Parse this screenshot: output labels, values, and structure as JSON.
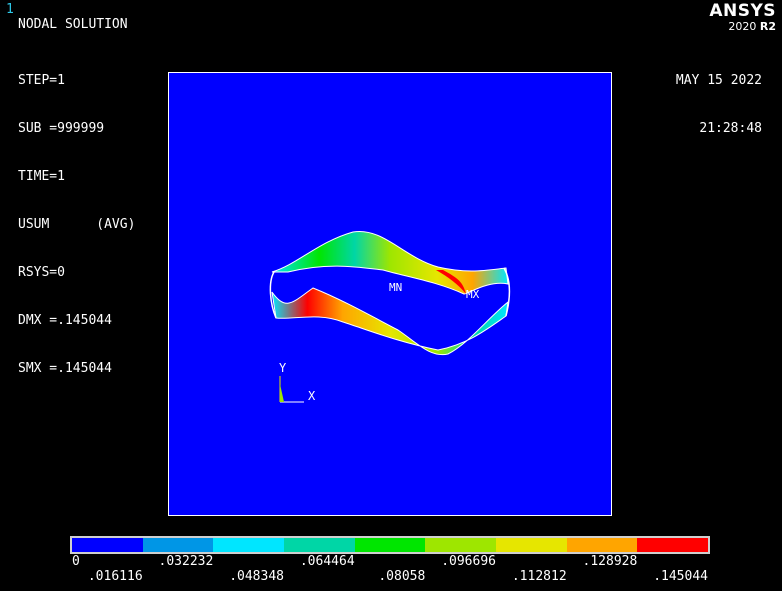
{
  "window_number": "1",
  "title": "NODAL SOLUTION",
  "info_lines": [
    "STEP=1",
    "SUB =999999",
    "TIME=1",
    "USUM      (AVG)",
    "RSYS=0",
    "DMX =.145044",
    "SMX =.145044"
  ],
  "date": "MAY 15 2022",
  "time": "21:28:48",
  "logo": {
    "brand": "ANSYS",
    "version": "2020",
    "release": "R2"
  },
  "labels": {
    "min": "MN",
    "max": "MX",
    "axis_y": "Y",
    "axis_x": "X"
  },
  "legend": {
    "colors": [
      "#0000ff",
      "#0096e6",
      "#00e6ff",
      "#00d6a6",
      "#00e600",
      "#9ee600",
      "#e6e600",
      "#ffa500",
      "#ff0000"
    ],
    "upper_ticks": [
      "0",
      ".032232",
      ".064464",
      ".096696",
      ".128928"
    ],
    "lower_ticks": [
      ".016116",
      ".048348",
      ".08058",
      ".112812",
      ".145044"
    ]
  },
  "colors": {
    "background": "#000000",
    "viewport": "#0000ff",
    "window_number": "#2ec8e8"
  }
}
